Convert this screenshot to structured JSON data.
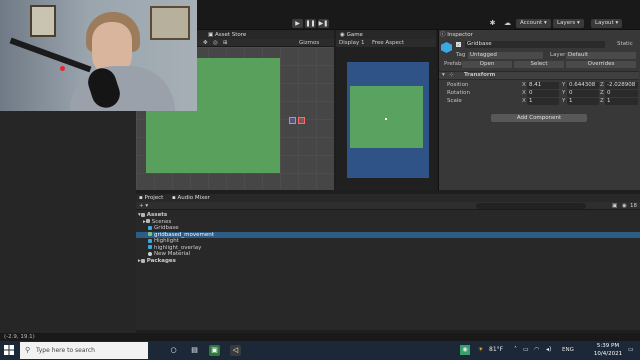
{
  "toolbar": {
    "play": "▶",
    "pause": "❚❚",
    "step": "▶❚",
    "account": "Account ▾",
    "layers": "Layers ▾",
    "layout": "Layout ▾"
  },
  "scene": {
    "tab": "Asset Store",
    "tools": [
      "✥",
      "◎",
      "⊞"
    ],
    "gizmos": "Gizmos"
  },
  "game": {
    "tab": "Game",
    "display": "Display 1",
    "aspect": "Free Aspect"
  },
  "inspector": {
    "tab": "Inspector",
    "object_name": "Gridbase",
    "static": "Static",
    "tag_label": "Tag",
    "tag_value": "Untagged",
    "layer_label": "Layer",
    "layer_value": "Default",
    "prefab_label": "Prefab",
    "open": "Open",
    "select": "Select",
    "overrides": "Overrides",
    "transform": "Transform",
    "rows": [
      {
        "label": "Position",
        "x": "8.41",
        "y": "0.644308",
        "z": "-2.028908"
      },
      {
        "label": "Rotation",
        "x": "0",
        "y": "0",
        "z": "0"
      },
      {
        "label": "Scale",
        "x": "1",
        "y": "1",
        "z": "1"
      }
    ],
    "axis": {
      "x": "X",
      "y": "Y",
      "z": "Z"
    },
    "add_component": "Add Component"
  },
  "project": {
    "tabs": [
      "Project",
      "Audio Mixer"
    ],
    "add": "+ ▾",
    "count": "18",
    "assets": "Assets",
    "items": [
      "Scenes",
      "Gridbase",
      "gridbased_movement",
      "Highlight",
      "highlight_overlay",
      "New Material"
    ],
    "packages": "Packages"
  },
  "status": "(-2.9, 19.1)",
  "taskbar": {
    "search": "Type here to search",
    "weather": "81°F",
    "lang": "ENG",
    "time": "5:39 PM",
    "date": "10/4/2021"
  },
  "colors": {
    "scene_green": "#58a05c",
    "game_blue": "#2f5287",
    "selection": "#2c5d87"
  }
}
